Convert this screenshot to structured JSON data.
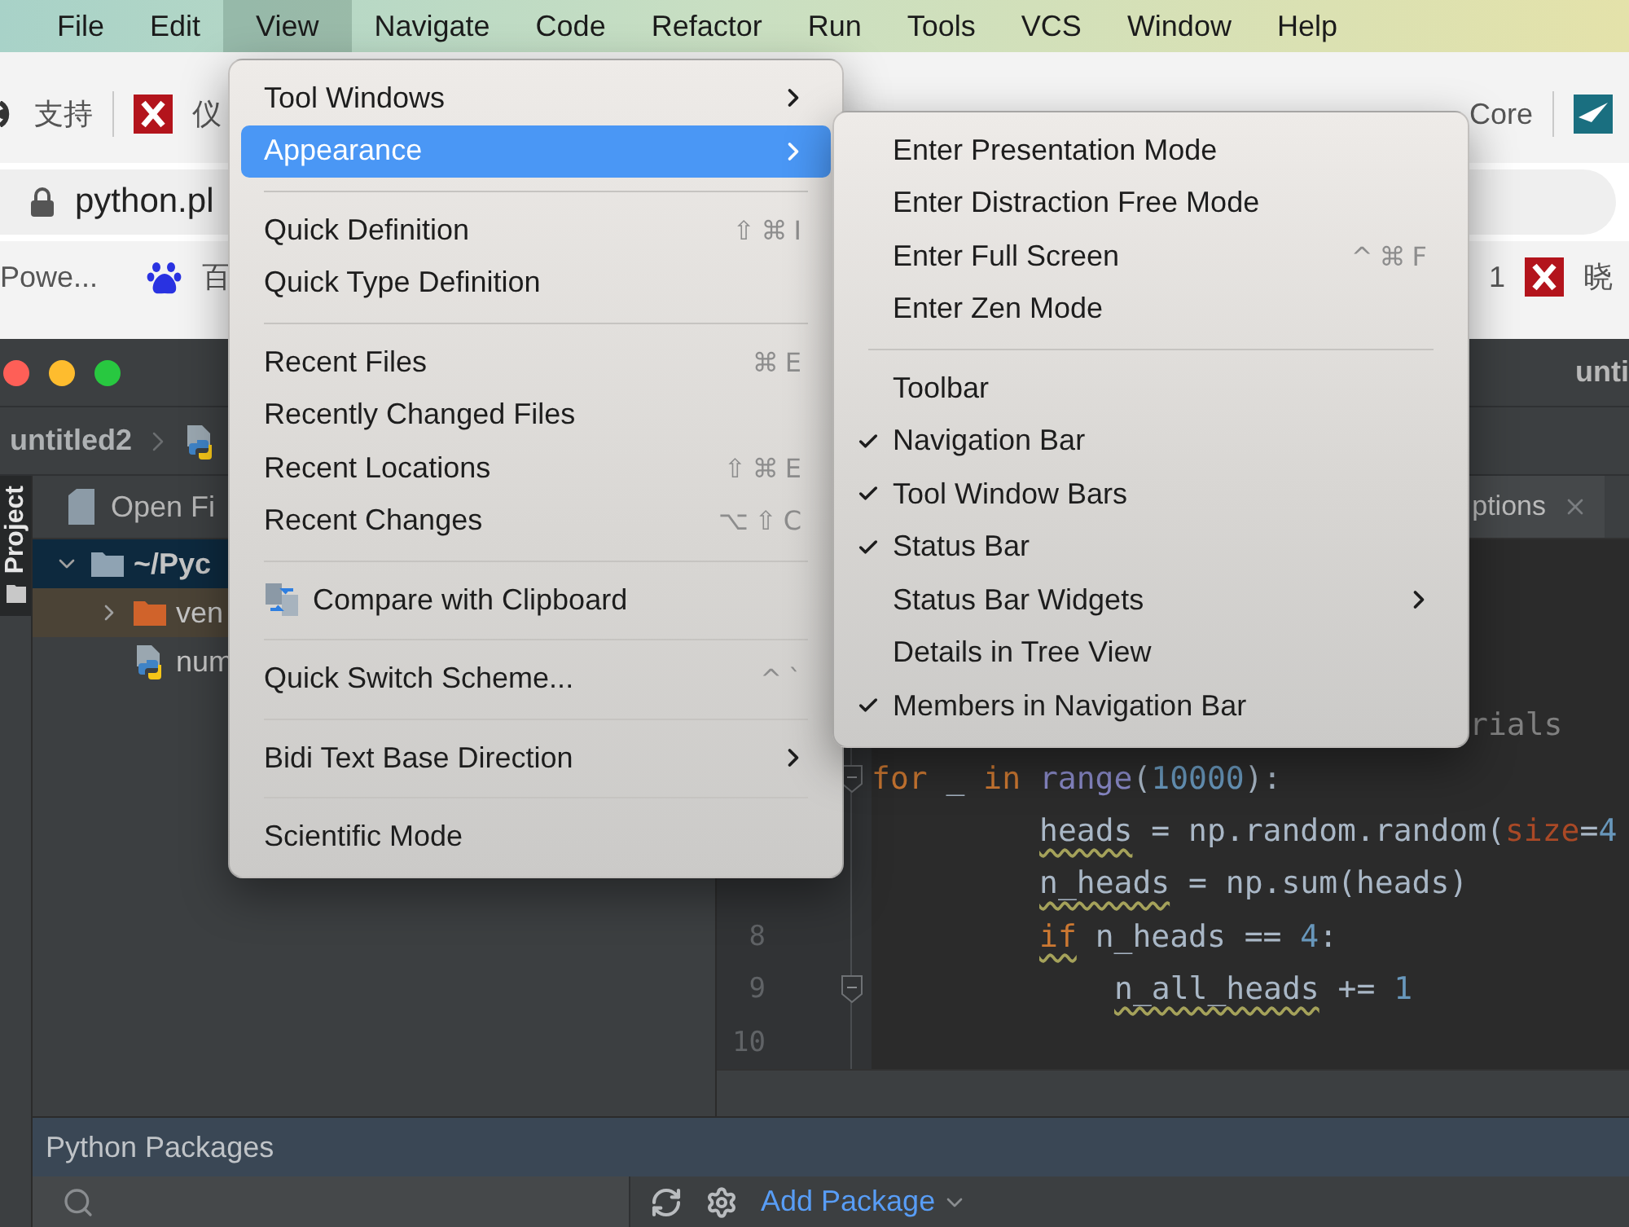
{
  "menubar": {
    "items": [
      {
        "label": "File",
        "selected": false
      },
      {
        "label": "Edit",
        "selected": false
      },
      {
        "label": "View",
        "selected": true
      },
      {
        "label": "Navigate",
        "selected": false
      },
      {
        "label": "Code",
        "selected": false
      },
      {
        "label": "Refactor",
        "selected": false
      },
      {
        "label": "Run",
        "selected": false
      },
      {
        "label": "Tools",
        "selected": false
      },
      {
        "label": "VCS",
        "selected": false
      },
      {
        "label": "Window",
        "selected": false
      },
      {
        "label": "Help",
        "selected": false
      }
    ]
  },
  "browser": {
    "top_left": [
      {
        "label": "支持",
        "kind": "circle"
      },
      {
        "label": "仪",
        "kind": "x"
      }
    ],
    "top_right": [
      {
        "label": "Core",
        "kind": "none"
      },
      {
        "kind": "plane"
      }
    ],
    "address": "python.pl",
    "bottom_left": [
      {
        "label": "Powe...",
        "kind": "none"
      },
      {
        "label": "百",
        "kind": "paw"
      }
    ],
    "bottom_right": [
      {
        "label": "1",
        "kind": "none"
      },
      {
        "label": "晓",
        "kind": "x"
      }
    ]
  },
  "ide": {
    "title": "unti",
    "breadcrumb": "untitled2",
    "stripe": {
      "label": "Project",
      "selected": true
    },
    "project": {
      "header": "Open Fi",
      "tree": [
        {
          "label": "~/Pyc",
          "kind": "folder",
          "selected": true,
          "expanded": true,
          "excluded": false,
          "children": [
            {
              "label": "ven",
              "kind": "folder",
              "selected": false,
              "expanded": false,
              "excluded": true
            },
            {
              "label": "num",
              "kind": "python",
              "selected": false,
              "excluded": false
            }
          ]
        }
      ]
    },
    "editor": {
      "tab": "ptions",
      "lines": [
        {
          "kind": "tail",
          "tokens": [
            {
              "text": "rials",
              "kind": "comment"
            }
          ]
        },
        {
          "kind": "top",
          "fold": true,
          "tokens": [
            {
              "text": "for",
              "kind": "keyword"
            },
            {
              "text": " _ ",
              "kind": "plain"
            },
            {
              "text": "in",
              "kind": "keyword"
            },
            {
              "text": " range",
              "kind": "builtin"
            },
            {
              "text": "(",
              "kind": "plain"
            },
            {
              "text": "10000",
              "kind": "number"
            },
            {
              "text": "):",
              "kind": "plain"
            }
          ]
        },
        {
          "kind": "block",
          "tokens": [
            {
              "text": "heads",
              "kind": "plain",
              "warn": true
            },
            {
              "text": " = np.random.random(",
              "kind": "plain"
            },
            {
              "text": "size",
              "kind": "param"
            },
            {
              "text": "=",
              "kind": "plain"
            },
            {
              "text": "4",
              "kind": "number"
            }
          ]
        },
        {
          "kind": "block",
          "tokens": [
            {
              "text": "n_heads",
              "kind": "plain",
              "warn": true
            },
            {
              "text": " = np.sum(heads)",
              "kind": "plain"
            }
          ]
        },
        {
          "kind": "block",
          "number": "8",
          "tokens": [
            {
              "text": "if",
              "kind": "keyword",
              "warn": true
            },
            {
              "text": " n_heads == ",
              "kind": "plain"
            },
            {
              "text": "4",
              "kind": "number"
            },
            {
              "text": ":",
              "kind": "plain"
            }
          ]
        },
        {
          "kind": "nested",
          "number": "9",
          "fold": true,
          "tokens": [
            {
              "text": "n_all_heads",
              "kind": "plain",
              "warn": true
            },
            {
              "text": " += ",
              "kind": "plain"
            },
            {
              "text": "1",
              "kind": "number"
            }
          ]
        },
        {
          "number": "10"
        }
      ]
    },
    "packages": {
      "title": "Python Packages",
      "add": "Add Package"
    }
  },
  "view_menu": {
    "items": [
      {
        "kind": "item",
        "label": "Tool Windows",
        "submenu": true,
        "selected": false
      },
      {
        "kind": "item",
        "label": "Appearance",
        "submenu": true,
        "selected": true
      },
      {
        "kind": "separator"
      },
      {
        "kind": "item",
        "label": "Quick Definition",
        "shortcut": "⇧⌘I",
        "selected": false
      },
      {
        "kind": "item",
        "label": "Quick Type Definition",
        "selected": false
      },
      {
        "kind": "separator"
      },
      {
        "kind": "item",
        "label": "Recent Files",
        "shortcut": "⌘E",
        "selected": false
      },
      {
        "kind": "item",
        "label": "Recently Changed Files",
        "selected": false
      },
      {
        "kind": "item",
        "label": "Recent Locations",
        "shortcut": "⇧⌘E",
        "selected": false
      },
      {
        "kind": "item",
        "label": "Recent Changes",
        "shortcut": "⌥⇧C",
        "selected": false
      },
      {
        "kind": "separator"
      },
      {
        "kind": "item",
        "label": "Compare with Clipboard",
        "icon": true,
        "selected": false
      },
      {
        "kind": "separator"
      },
      {
        "kind": "item",
        "label": "Quick Switch Scheme...",
        "shortcut": "^`",
        "selected": false
      },
      {
        "kind": "separator"
      },
      {
        "kind": "item",
        "label": "Bidi Text Base Direction",
        "submenu": true,
        "selected": false
      },
      {
        "kind": "separator"
      },
      {
        "kind": "item",
        "label": "Scientific Mode",
        "selected": false
      }
    ]
  },
  "appearance_menu": {
    "items": [
      {
        "kind": "item",
        "label": "Enter Presentation Mode",
        "checked": false
      },
      {
        "kind": "item",
        "label": "Enter Distraction Free Mode",
        "checked": false
      },
      {
        "kind": "item",
        "label": "Enter Full Screen",
        "shortcut": "^⌘F",
        "checked": false
      },
      {
        "kind": "item",
        "label": "Enter Zen Mode",
        "checked": false
      },
      {
        "kind": "separator"
      },
      {
        "kind": "item",
        "label": "Toolbar",
        "checked": false
      },
      {
        "kind": "item",
        "label": "Navigation Bar",
        "checked": true
      },
      {
        "kind": "item",
        "label": "Tool Window Bars",
        "checked": true
      },
      {
        "kind": "item",
        "label": "Status Bar",
        "checked": true
      },
      {
        "kind": "item",
        "label": "Status Bar Widgets",
        "submenu": true,
        "checked": false
      },
      {
        "kind": "item",
        "label": "Details in Tree View",
        "checked": false
      },
      {
        "kind": "item",
        "label": "Members in Navigation Bar",
        "checked": true
      }
    ]
  }
}
